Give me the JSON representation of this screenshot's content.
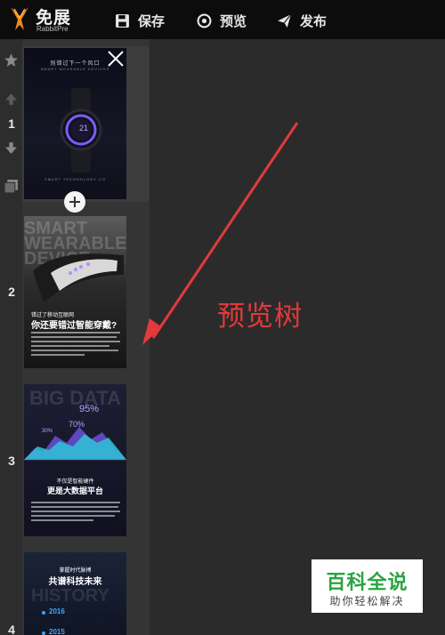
{
  "app": {
    "logo_name": "免展",
    "logo_sub": "RabbitPre"
  },
  "toolbar": {
    "save_label": "保存",
    "preview_label": "预览",
    "publish_label": "发布"
  },
  "pages": [
    {
      "number": "1",
      "heading": "别错过下一个风口",
      "sub": "SMART WEARABLE DEVICES",
      "watch_time": "21",
      "footer": "SMART TECHNOLOGY CO"
    },
    {
      "number": "2",
      "big": "SMART WEARABLE DEVICE",
      "question_small": "错过了移动互联网",
      "question": "你还要错过智能穿戴?"
    },
    {
      "number": "3",
      "big": "BIG DATA",
      "pct1": "95%",
      "pct2": "70%",
      "pct3": "30%",
      "caption_small": "不仅是智能硬件",
      "caption": "更是大数据平台"
    },
    {
      "number": "4",
      "heading_small": "掌握时代脉搏",
      "heading": "共谱科技未来",
      "big": "HISTORY",
      "year1": "2016",
      "year2": "2015"
    }
  ],
  "annotation": {
    "label": "预览树",
    "color": "#e23a3a"
  },
  "watermark": {
    "title": "百科全说",
    "subtitle": "助你轻松解决"
  },
  "colors": {
    "topbar": "#0c0c0c",
    "panel": "#343434",
    "canvas": "#2b2b2b",
    "accent_purple": "#7b5cff",
    "chart_cyan": "#2ec5d6"
  }
}
